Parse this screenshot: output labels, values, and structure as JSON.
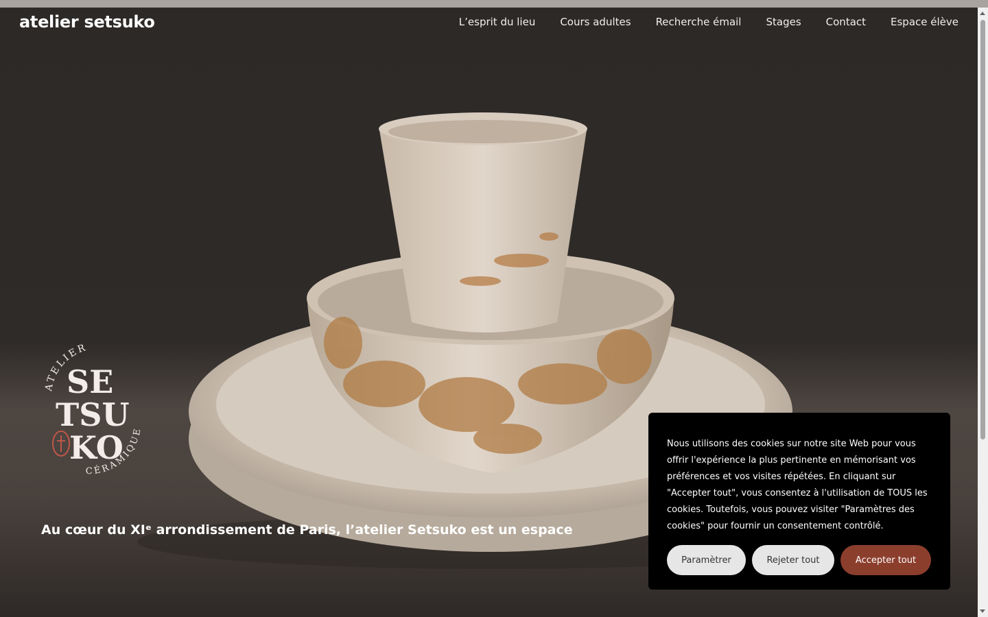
{
  "topbar": {},
  "header": {
    "brand": "atelier setsuko",
    "nav": [
      "L’esprit du lieu",
      "Cours adultes",
      "Recherche émail",
      "Stages",
      "Contact",
      "Espace élève"
    ]
  },
  "logo": {
    "arc_top": "ATELIER",
    "line1": "SE",
    "line2": "TSU",
    "line3": "KO",
    "arc_bottom": "CÉRAMIQUE"
  },
  "hero": {
    "text": "Au cœur du XIᵉ arrondissement de Paris, l’atelier Setsuko est un espace dédié"
  },
  "cookie": {
    "text": "Nous utilisons des cookies  sur notre site Web pour vous offrir l'expérience la plus pertinente en mémorisant vos préférences et vos visites répétées. En cliquant sur \"Accepter tout\", vous consentez à l'utilisation de TOUS les cookies. Toutefois, vous pouvez visiter \"Paramètres des cookies\" pour fournir un consentement contrôlé.",
    "settings_label": "Paramètrer",
    "reject_label": "Rejeter tout",
    "accept_label": "Accepter tout"
  },
  "colors": {
    "accent": "#8c3e2d",
    "cookie_bg": "#000000",
    "light_button": "#e6e6e6"
  }
}
